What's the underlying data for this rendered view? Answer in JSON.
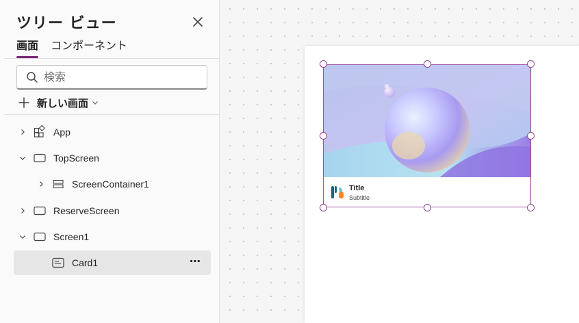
{
  "panel": {
    "title": "ツリー ビュー",
    "tabs": [
      {
        "label": "画面",
        "active": true
      },
      {
        "label": "コンポーネント",
        "active": false
      }
    ],
    "search": {
      "placeholder": "検索",
      "value": ""
    },
    "new_screen_label": "新しい画面"
  },
  "tree": {
    "items": [
      {
        "label": "App",
        "icon": "app-icon",
        "expanded": false
      },
      {
        "label": "TopScreen",
        "icon": "screen-icon",
        "expanded": true
      },
      {
        "label": "ScreenContainer1",
        "icon": "container-icon",
        "expanded": false
      },
      {
        "label": "ReserveScreen",
        "icon": "screen-icon",
        "expanded": false
      },
      {
        "label": "Screen1",
        "icon": "screen-icon",
        "expanded": true
      },
      {
        "label": "Card1",
        "icon": "card-icon",
        "selected": true
      }
    ],
    "more_label": "⋯"
  },
  "card": {
    "title": "Title",
    "subtitle": "Subtitle",
    "logo": "kitchen-utensils-icon"
  },
  "colors": {
    "accent": "#742774",
    "selection": "#9c4f9c",
    "selected_row": "#e6e6e6"
  }
}
